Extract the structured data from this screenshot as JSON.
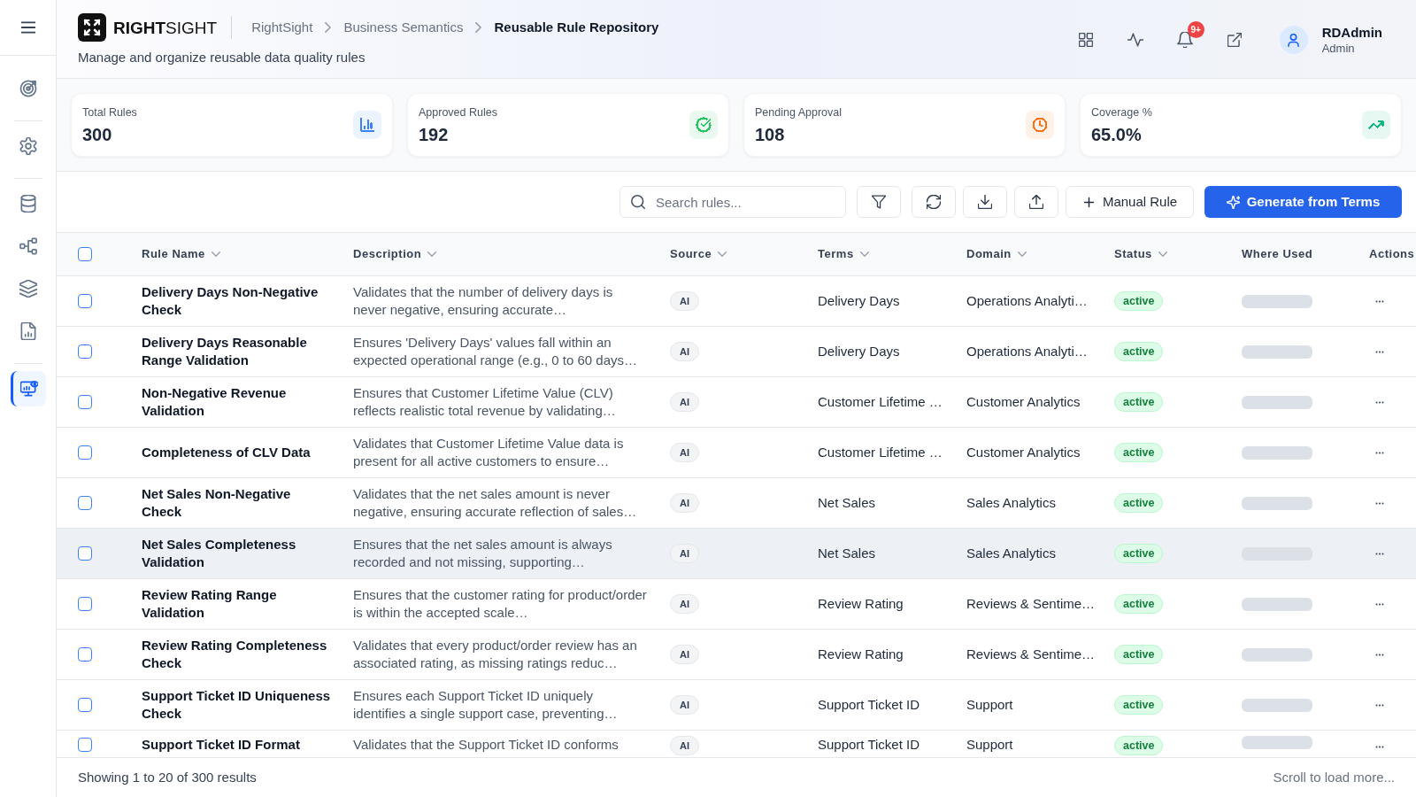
{
  "sidebar": {
    "groups": [
      {
        "items": [
          {
            "selected": false
          }
        ]
      },
      {
        "items": [
          {
            "selected": false
          }
        ]
      },
      {
        "items": [
          {
            "selected": false
          },
          {
            "selected": false
          },
          {
            "selected": false
          },
          {
            "selected": false
          }
        ]
      },
      {
        "items": [
          {
            "selected": true
          }
        ]
      }
    ]
  },
  "header": {
    "logo": "**RIGHT**SIGHT",
    "breadcrumb": [
      {
        "label": "RightSight",
        "current": false
      },
      {
        "label": "Business Semantics",
        "current": false
      },
      {
        "label": "Reusable Rule Repository",
        "current": true
      }
    ],
    "subtitle": "Manage and organize reusable data quality rules",
    "notification_badge": "9+",
    "user": {
      "name": "RDAdmin",
      "role": "Admin"
    }
  },
  "stats": [
    {
      "label": "Total Rules",
      "value": "300",
      "color": "#3b82f6"
    },
    {
      "label": "Approved Rules",
      "value": "192",
      "color": "#22c55e"
    },
    {
      "label": "Pending Approval",
      "value": "108",
      "color": "#f97316"
    },
    {
      "label": "Coverage %",
      "value": "65.0%",
      "color": "#10b981"
    }
  ],
  "toolbar": {
    "search": {
      "placeholder": "Search rules..."
    },
    "buttons": [
      {
        "label": "Manual Rule",
        "kind": "secondary"
      },
      {
        "label": "Generate from Terms",
        "kind": "primary"
      }
    ]
  },
  "table": {
    "select_all": {
      "checked": false
    },
    "columns": [
      {
        "label": "Rule Name",
        "sortable": true
      },
      {
        "label": "Description",
        "sortable": true
      },
      {
        "label": "Source",
        "sortable": true
      },
      {
        "label": "Terms",
        "sortable": true
      },
      {
        "label": "Domain",
        "sortable": true
      },
      {
        "label": "Status",
        "sortable": true
      },
      {
        "label": "Where Used",
        "sortable": false
      },
      {
        "label": "Actions",
        "sortable": false
      }
    ],
    "rows": [
      {
        "name": "Delivery Days Non-Negative Check",
        "description": "Validates that the number of delivery days is never negative, ensuring accurate…",
        "source": "AI",
        "terms": "Delivery Days",
        "domain": "Operations Analyti…",
        "status": "active",
        "selected": false,
        "hovered": false
      },
      {
        "name": "Delivery Days Reasonable Range Validation",
        "description": "Ensures 'Delivery Days' values fall within an expected operational range (e.g., 0 to 60 days…",
        "source": "AI",
        "terms": "Delivery Days",
        "domain": "Operations Analyti…",
        "status": "active",
        "selected": false,
        "hovered": false
      },
      {
        "name": "Non-Negative Revenue Validation",
        "description": "Ensures that Customer Lifetime Value (CLV) reflects realistic total revenue by validating…",
        "source": "AI",
        "terms": "Customer Lifetime …",
        "domain": "Customer Analytics",
        "status": "active",
        "selected": false,
        "hovered": false
      },
      {
        "name": "Completeness of CLV Data",
        "description": "Validates that Customer Lifetime Value data is present for all active customers to ensure…",
        "source": "AI",
        "terms": "Customer Lifetime …",
        "domain": "Customer Analytics",
        "status": "active",
        "selected": false,
        "hovered": false
      },
      {
        "name": "Net Sales Non-Negative Check",
        "description": "Validates that the net sales amount is never negative, ensuring accurate reflection of sales…",
        "source": "AI",
        "terms": "Net Sales",
        "domain": "Sales Analytics",
        "status": "active",
        "selected": false,
        "hovered": false
      },
      {
        "name": "Net Sales Completeness Validation",
        "description": "Ensures that the net sales amount is always recorded and not missing, supporting…",
        "source": "AI",
        "terms": "Net Sales",
        "domain": "Sales Analytics",
        "status": "active",
        "selected": false,
        "hovered": true
      },
      {
        "name": "Review Rating Range Validation",
        "description": "Ensures that the customer rating for product/order is within the accepted scale…",
        "source": "AI",
        "terms": "Review Rating",
        "domain": "Reviews & Sentime…",
        "status": "active",
        "selected": false,
        "hovered": false
      },
      {
        "name": "Review Rating Completeness Check",
        "description": "Validates that every product/order review has an associated rating, as missing ratings reduc…",
        "source": "AI",
        "terms": "Review Rating",
        "domain": "Reviews & Sentime…",
        "status": "active",
        "selected": false,
        "hovered": false
      },
      {
        "name": "Support Ticket ID Uniqueness Check",
        "description": "Ensures each Support Ticket ID uniquely identifies a single support case, preventing…",
        "source": "AI",
        "terms": "Support Ticket ID",
        "domain": "Support",
        "status": "active",
        "selected": false,
        "hovered": false
      },
      {
        "name": "Support Ticket ID Format",
        "description": "Validates that the Support Ticket ID conforms",
        "source": "AI",
        "terms": "Support Ticket ID",
        "domain": "Support",
        "status": "active",
        "selected": false,
        "hovered": false
      }
    ]
  },
  "footer": {
    "summary": "Showing 1 to 20 of 300 results",
    "hint": "Scroll to load more..."
  }
}
